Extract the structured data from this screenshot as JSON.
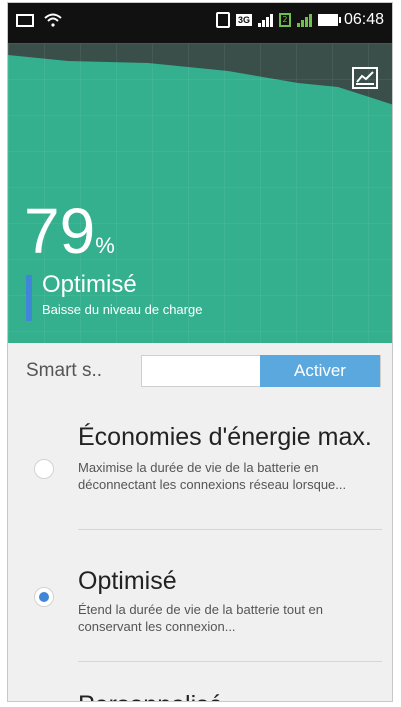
{
  "status_bar": {
    "time": "06:48",
    "sim_label": "3G",
    "sim2_label": "2",
    "icons": [
      "image-icon",
      "wifi-icon",
      "vibrate-icon",
      "sim-icon",
      "signal-icon",
      "sim2-icon",
      "signal-green-icon",
      "battery-icon"
    ]
  },
  "battery": {
    "percent": "79",
    "percent_sign": "%",
    "mode_title": "Optimisé",
    "mode_subtitle": "Baisse du niveau de charge",
    "header_color": "#3a4f4a",
    "graph_color": "#34b08f",
    "chart_button_icon": "chart-icon"
  },
  "smart": {
    "label": "Smart s..",
    "button_label": "Activer",
    "button_color": "#5ba8de"
  },
  "options": [
    {
      "title": "Économies d'énergie max.",
      "description": "Maximise la durée de vie de la batterie en déconnectant les connexions réseau lorsque...",
      "selected": false
    },
    {
      "title": "Optimisé",
      "description": "Étend la durée de vie de la batterie tout en conservant les connexion...",
      "selected": true
    },
    {
      "title": "Personnalisé",
      "description": "",
      "selected": false
    }
  ],
  "accent_color": "#3f86d8"
}
